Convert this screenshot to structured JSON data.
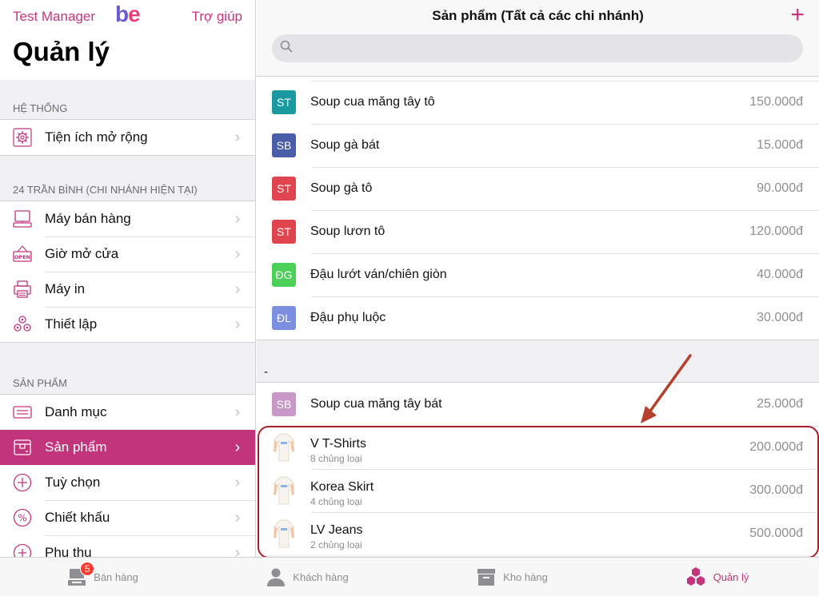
{
  "sidebar": {
    "app_name": "Test Manager",
    "logo_text": "be",
    "help_label": "Trợ giúp",
    "title": "Quản lý",
    "sections": [
      {
        "header": "HỆ THỐNG",
        "items": [
          {
            "label": "Tiện ích mở rộng",
            "icon": "gear-icon"
          }
        ]
      },
      {
        "header": "24 TRẦN BÌNH (CHI NHÁNH HIỆN TẠI)",
        "items": [
          {
            "label": "Máy bán hàng",
            "icon": "pos-terminal-icon"
          },
          {
            "label": "Giờ mở cửa",
            "icon": "open-sign-icon"
          },
          {
            "label": "Máy in",
            "icon": "printer-icon"
          },
          {
            "label": "Thiết lập",
            "icon": "gears-icon"
          }
        ]
      },
      {
        "header": "SẢN PHẨM",
        "items": [
          {
            "label": "Danh mục",
            "icon": "category-icon"
          },
          {
            "label": "Sản phẩm",
            "icon": "product-box-icon",
            "active": true
          },
          {
            "label": "Tuỳ chọn",
            "icon": "plus-circle-icon"
          },
          {
            "label": "Chiết khấu",
            "icon": "percent-circle-icon"
          },
          {
            "label": "Phụ thu",
            "icon": "plus-circle-icon"
          }
        ]
      }
    ]
  },
  "main": {
    "title": "Sản phẩm (Tất cả các chi nhánh)",
    "add_icon": "plus-icon",
    "search": {
      "placeholder": ""
    },
    "products_top": [
      {
        "initials": "ST",
        "color": "#1a9aa0",
        "name": "Soup cua măng tây tô",
        "price": "150.000đ"
      },
      {
        "initials": "SB",
        "color": "#4a5da8",
        "name": "Soup gà bát",
        "price": "15.000đ"
      },
      {
        "initials": "ST",
        "color": "#e0454f",
        "name": "Soup gà tô",
        "price": "90.000đ"
      },
      {
        "initials": "ST",
        "color": "#e0454f",
        "name": "Soup lươn tô",
        "price": "120.000đ"
      },
      {
        "initials": "ĐG",
        "color": "#4cd058",
        "name": "Đậu lướt ván/chiên giòn",
        "price": "40.000đ"
      },
      {
        "initials": "ĐL",
        "color": "#7b8fe0",
        "name": "Đậu phụ luộc",
        "price": "30.000đ"
      }
    ],
    "section_dash": "-",
    "products_bottom": [
      {
        "initials": "SB",
        "color": "#c898c8",
        "name": "Soup cua măng tây bát",
        "price": "25.000đ"
      },
      {
        "thumb": "tshirt-thumbnail",
        "name": "V T-Shirts",
        "variants": "8 chủng loại",
        "price": "200.000đ"
      },
      {
        "thumb": "tshirt-thumbnail",
        "name": "Korea Skirt",
        "variants": "4 chủng loại",
        "price": "300.000đ"
      },
      {
        "thumb": "tshirt-thumbnail",
        "name": "LV Jeans",
        "variants": "2 chủng loại",
        "price": "500.000đ"
      }
    ]
  },
  "tabbar": {
    "tabs": [
      {
        "label": "Bán hàng",
        "icon": "pos-icon",
        "badge": "5"
      },
      {
        "label": "Khách hàng",
        "icon": "person-icon"
      },
      {
        "label": "Kho hàng",
        "icon": "archive-box-icon"
      },
      {
        "label": "Quản lý",
        "icon": "hexagons-icon",
        "active": true
      }
    ]
  },
  "colors": {
    "accent": "#c2347c",
    "annotation": "#a8202a"
  }
}
